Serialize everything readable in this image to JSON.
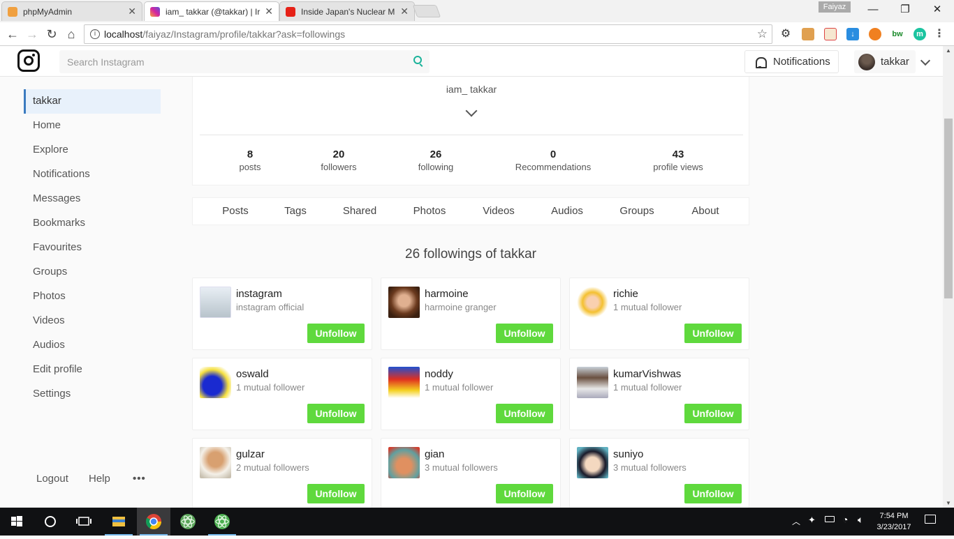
{
  "browser": {
    "tabs": [
      {
        "title": "phpMyAdmin",
        "favicon": "phpmyadmin-icon"
      },
      {
        "title": "iam_ takkar (@takkar) | Ir",
        "favicon": "instagram-icon"
      },
      {
        "title": "Inside Japan's Nuclear M",
        "favicon": "youtube-icon"
      }
    ],
    "profile_chip": "Faiyaz",
    "url_host": "localhost",
    "url_path": "/faiyaz/Instagram/profile/takkar?ask=followings"
  },
  "topbar": {
    "search_placeholder": "Search Instagram",
    "notifications_label": "Notifications",
    "username": "takkar"
  },
  "sidebar": {
    "items": [
      {
        "label": "takkar",
        "active": true
      },
      {
        "label": "Home"
      },
      {
        "label": "Explore"
      },
      {
        "label": "Notifications"
      },
      {
        "label": "Messages"
      },
      {
        "label": "Bookmarks"
      },
      {
        "label": "Favourites"
      },
      {
        "label": "Groups"
      },
      {
        "label": "Photos"
      },
      {
        "label": "Videos"
      },
      {
        "label": "Audios"
      },
      {
        "label": "Edit profile"
      },
      {
        "label": "Settings"
      }
    ],
    "footer": {
      "logout": "Logout",
      "help": "Help",
      "more": "•••"
    }
  },
  "profile": {
    "full_name": "iam_ takkar",
    "stats": [
      {
        "value": "8",
        "label": "posts"
      },
      {
        "value": "20",
        "label": "followers"
      },
      {
        "value": "26",
        "label": "following"
      },
      {
        "value": "0",
        "label": "Recommendations"
      },
      {
        "value": "43",
        "label": "profile views"
      }
    ],
    "tabs": [
      "Posts",
      "Tags",
      "Shared",
      "Photos",
      "Videos",
      "Audios",
      "Groups",
      "About"
    ]
  },
  "followings": {
    "heading": "26 followings of takkar",
    "button_label": "Unfollow",
    "users": [
      {
        "username": "instagram",
        "subtitle": "instagram official"
      },
      {
        "username": "harmoine",
        "subtitle": "harmoine granger"
      },
      {
        "username": "richie",
        "subtitle": "1 mutual follower"
      },
      {
        "username": "oswald",
        "subtitle": "1 mutual follower"
      },
      {
        "username": "noddy",
        "subtitle": "1 mutual follower"
      },
      {
        "username": "kumarVishwas",
        "subtitle": "1 mutual follower"
      },
      {
        "username": "gulzar",
        "subtitle": "2 mutual followers"
      },
      {
        "username": "gian",
        "subtitle": "3 mutual followers"
      },
      {
        "username": "suniyo",
        "subtitle": "3 mutual followers"
      }
    ]
  },
  "taskbar": {
    "time": "7:54 PM",
    "date": "3/23/2017"
  },
  "colors": {
    "accent_green": "#5fd93d",
    "active_blue": "#3b7bc0",
    "search_teal": "#1bb39a"
  }
}
